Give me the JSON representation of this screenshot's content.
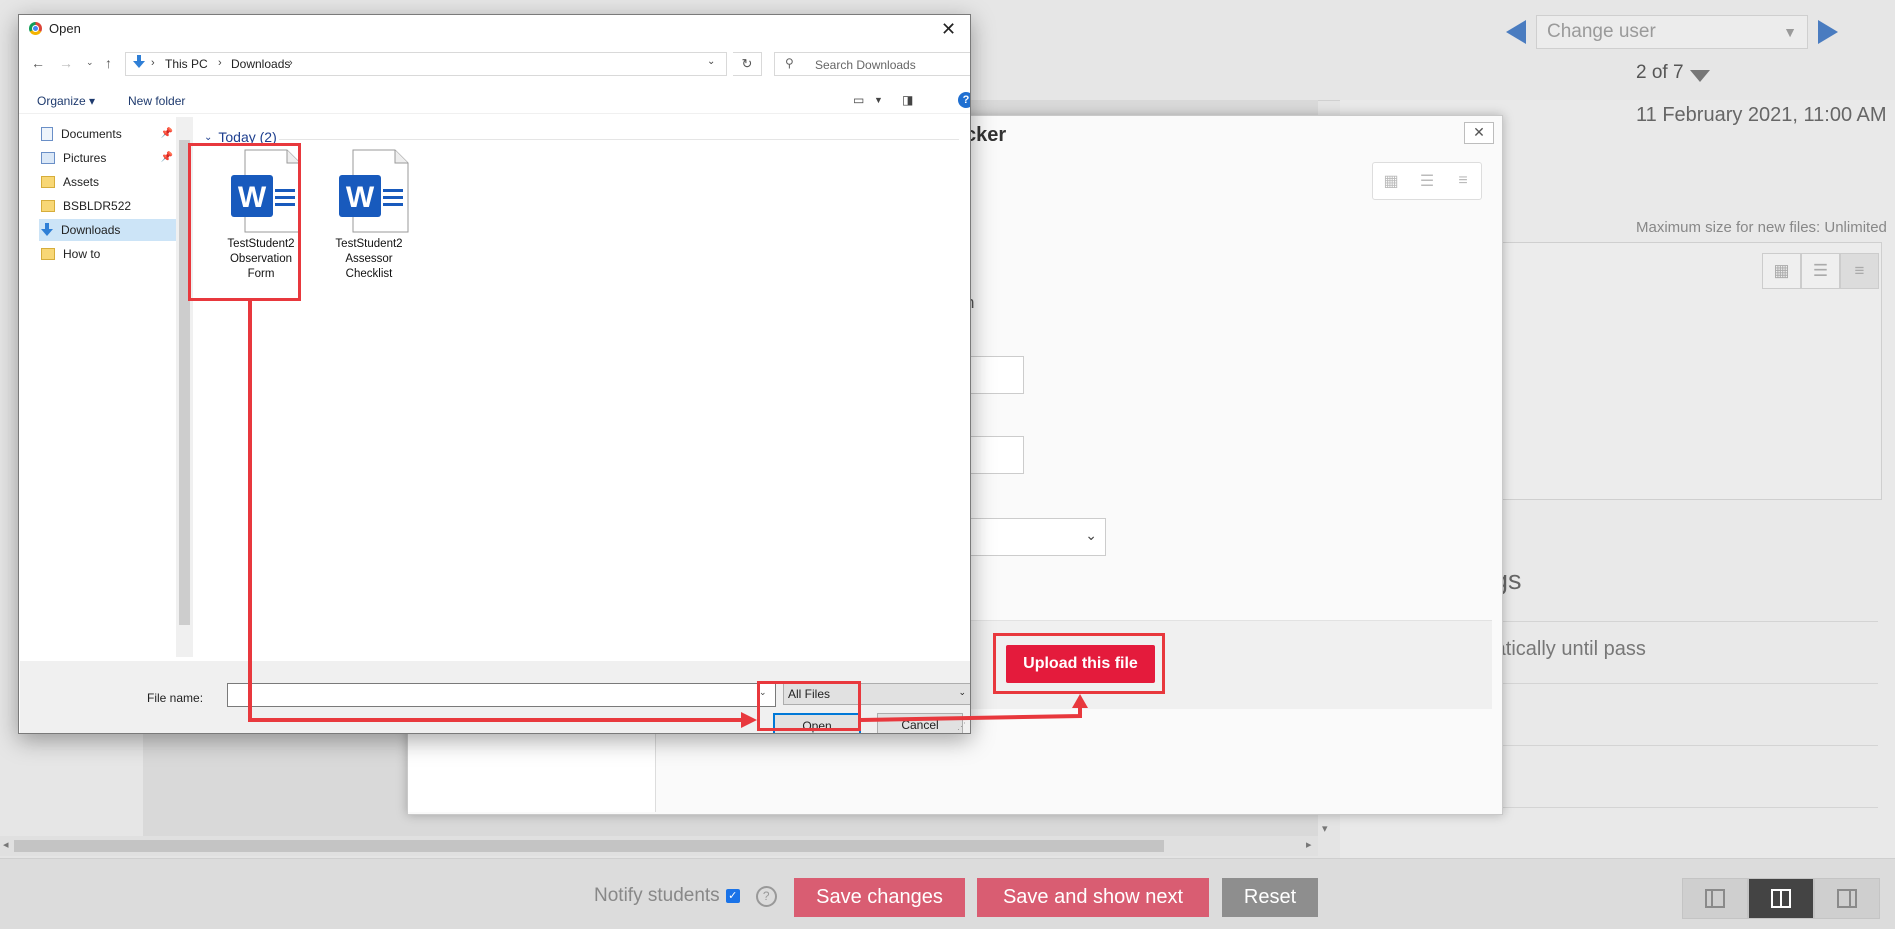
{
  "grading": {
    "change_user_placeholder": "Change user",
    "user_count": "2 of 7",
    "due_date": "11 February 2021, 11:00 AM",
    "max_size": "Maximum size for new files: Unlimited",
    "section_partial": "ngs",
    "attempts_partial": "matically until pass",
    "notify_label": "Notify students",
    "help_symbol": "?",
    "buttons": {
      "save": "Save changes",
      "save_next": "Save and show next",
      "reset": "Reset"
    },
    "layout_buttons": [
      "collapse-grade-panel",
      "default-view",
      "collapse-review-panel"
    ],
    "active_layout": "default-view"
  },
  "file_picker": {
    "title_partial": "cker",
    "close_symbol": "✕",
    "label_partial": "n",
    "upload_button": "Upload this file"
  },
  "open_dialog": {
    "title": "Open",
    "close_symbol": "✕",
    "breadcrumb": [
      "This PC",
      "Downloads"
    ],
    "search_placeholder": "Search Downloads",
    "organize_label": "Organize",
    "new_folder_label": "New folder",
    "nav_items": [
      {
        "label": "Documents",
        "icon": "documents-icon",
        "pinned": true
      },
      {
        "label": "Pictures",
        "icon": "pictures-icon",
        "pinned": true
      },
      {
        "label": "Assets",
        "icon": "folder-icon",
        "pinned": false
      },
      {
        "label": "BSBLDR522",
        "icon": "folder-icon",
        "pinned": false
      },
      {
        "label": "Downloads",
        "icon": "downloads-icon",
        "pinned": false,
        "selected": true
      },
      {
        "label": "How to",
        "icon": "folder-icon",
        "pinned": false
      }
    ],
    "group_label": "Today (2)",
    "files": [
      {
        "lines": [
          "TestStudent2",
          "Observation",
          "Form"
        ],
        "type": "word",
        "highlighted": true
      },
      {
        "lines": [
          "TestStudent2",
          "Assessor",
          "Checklist"
        ],
        "type": "word",
        "highlighted": false
      }
    ],
    "file_name_label": "File name:",
    "file_name_value": "",
    "file_type": "All Files",
    "open_button": "Open",
    "cancel_button": "Cancel"
  },
  "colors": {
    "annotation_red": "#e8383d",
    "upload_red": "#e41b3c",
    "nav_blue": "#4a7cc0",
    "word_blue": "#185abd"
  }
}
